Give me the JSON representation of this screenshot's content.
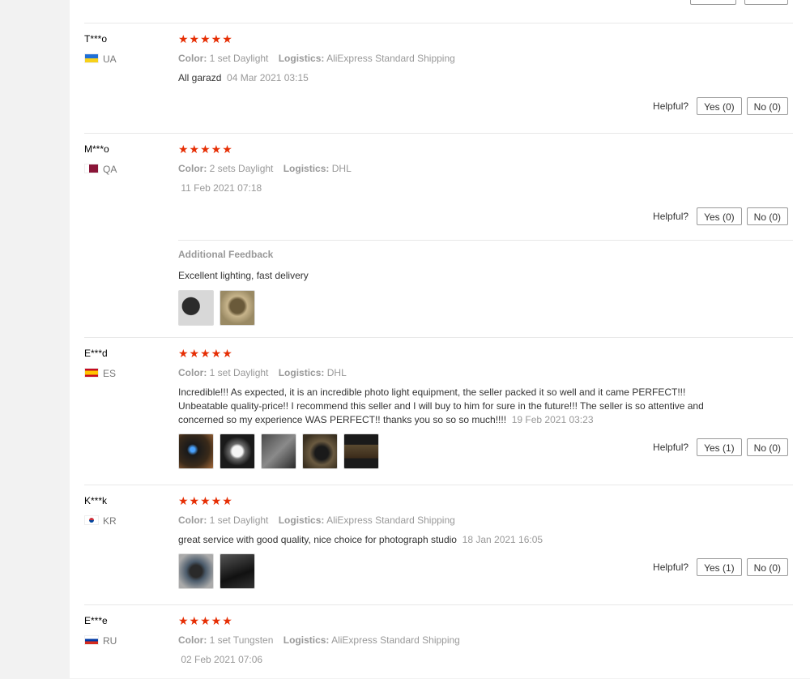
{
  "reviews": [
    {
      "user": "T***o",
      "country": "UA",
      "flag": "ua",
      "stars": "★★★★★",
      "color_label": "Color:",
      "color_value": "1 set Daylight",
      "logistics_label": "Logistics:",
      "logistics_value": "AliExpress Standard Shipping",
      "text": "All garazd",
      "date": "04 Mar 2021 03:15",
      "helpful_label": "Helpful?",
      "yes": "Yes (0)",
      "no": "No (0)"
    },
    {
      "user": "M***o",
      "country": "QA",
      "flag": "qa",
      "stars": "★★★★★",
      "color_label": "Color:",
      "color_value": "2 sets Daylight",
      "logistics_label": "Logistics:",
      "logistics_value": "DHL",
      "text": "",
      "date": "11 Feb 2021 07:18",
      "helpful_label": "Helpful?",
      "yes": "Yes (0)",
      "no": "No (0)",
      "additional_title": "Additional Feedback",
      "additional_text": "Excellent lighting, fast delivery"
    },
    {
      "user": "E***d",
      "country": "ES",
      "flag": "es",
      "stars": "★★★★★",
      "color_label": "Color:",
      "color_value": "1 set Daylight",
      "logistics_label": "Logistics:",
      "logistics_value": "DHL",
      "text": "Incredible!!! As expected, it is an incredible photo light equipment, the seller packed it so well and it came PERFECT!!! Unbeatable quality-price!! I recommend this seller and I will buy to him for sure in the future!!! The seller is so attentive and concerned so my experience WAS PERFECT!! thanks you so so so much!!!!",
      "date": "19 Feb 2021 03:23",
      "helpful_label": "Helpful?",
      "yes": "Yes (1)",
      "no": "No (0)"
    },
    {
      "user": "K***k",
      "country": "KR",
      "flag": "kr",
      "stars": "★★★★★",
      "color_label": "Color:",
      "color_value": "1 set Daylight",
      "logistics_label": "Logistics:",
      "logistics_value": "AliExpress Standard Shipping",
      "text": "great service with good quality, nice choice for photograph studio",
      "date": "18 Jan 2021 16:05",
      "helpful_label": "Helpful?",
      "yes": "Yes (1)",
      "no": "No (0)"
    },
    {
      "user": "E***e",
      "country": "RU",
      "flag": "ru",
      "stars": "★★★★★",
      "color_label": "Color:",
      "color_value": "1 set Tungsten",
      "logistics_label": "Logistics:",
      "logistics_value": "AliExpress Standard Shipping",
      "text": "",
      "date": "02 Feb 2021 07:06"
    }
  ],
  "colors": {
    "star": "#e62e04",
    "muted": "#999999",
    "border": "#e8e8e8"
  }
}
